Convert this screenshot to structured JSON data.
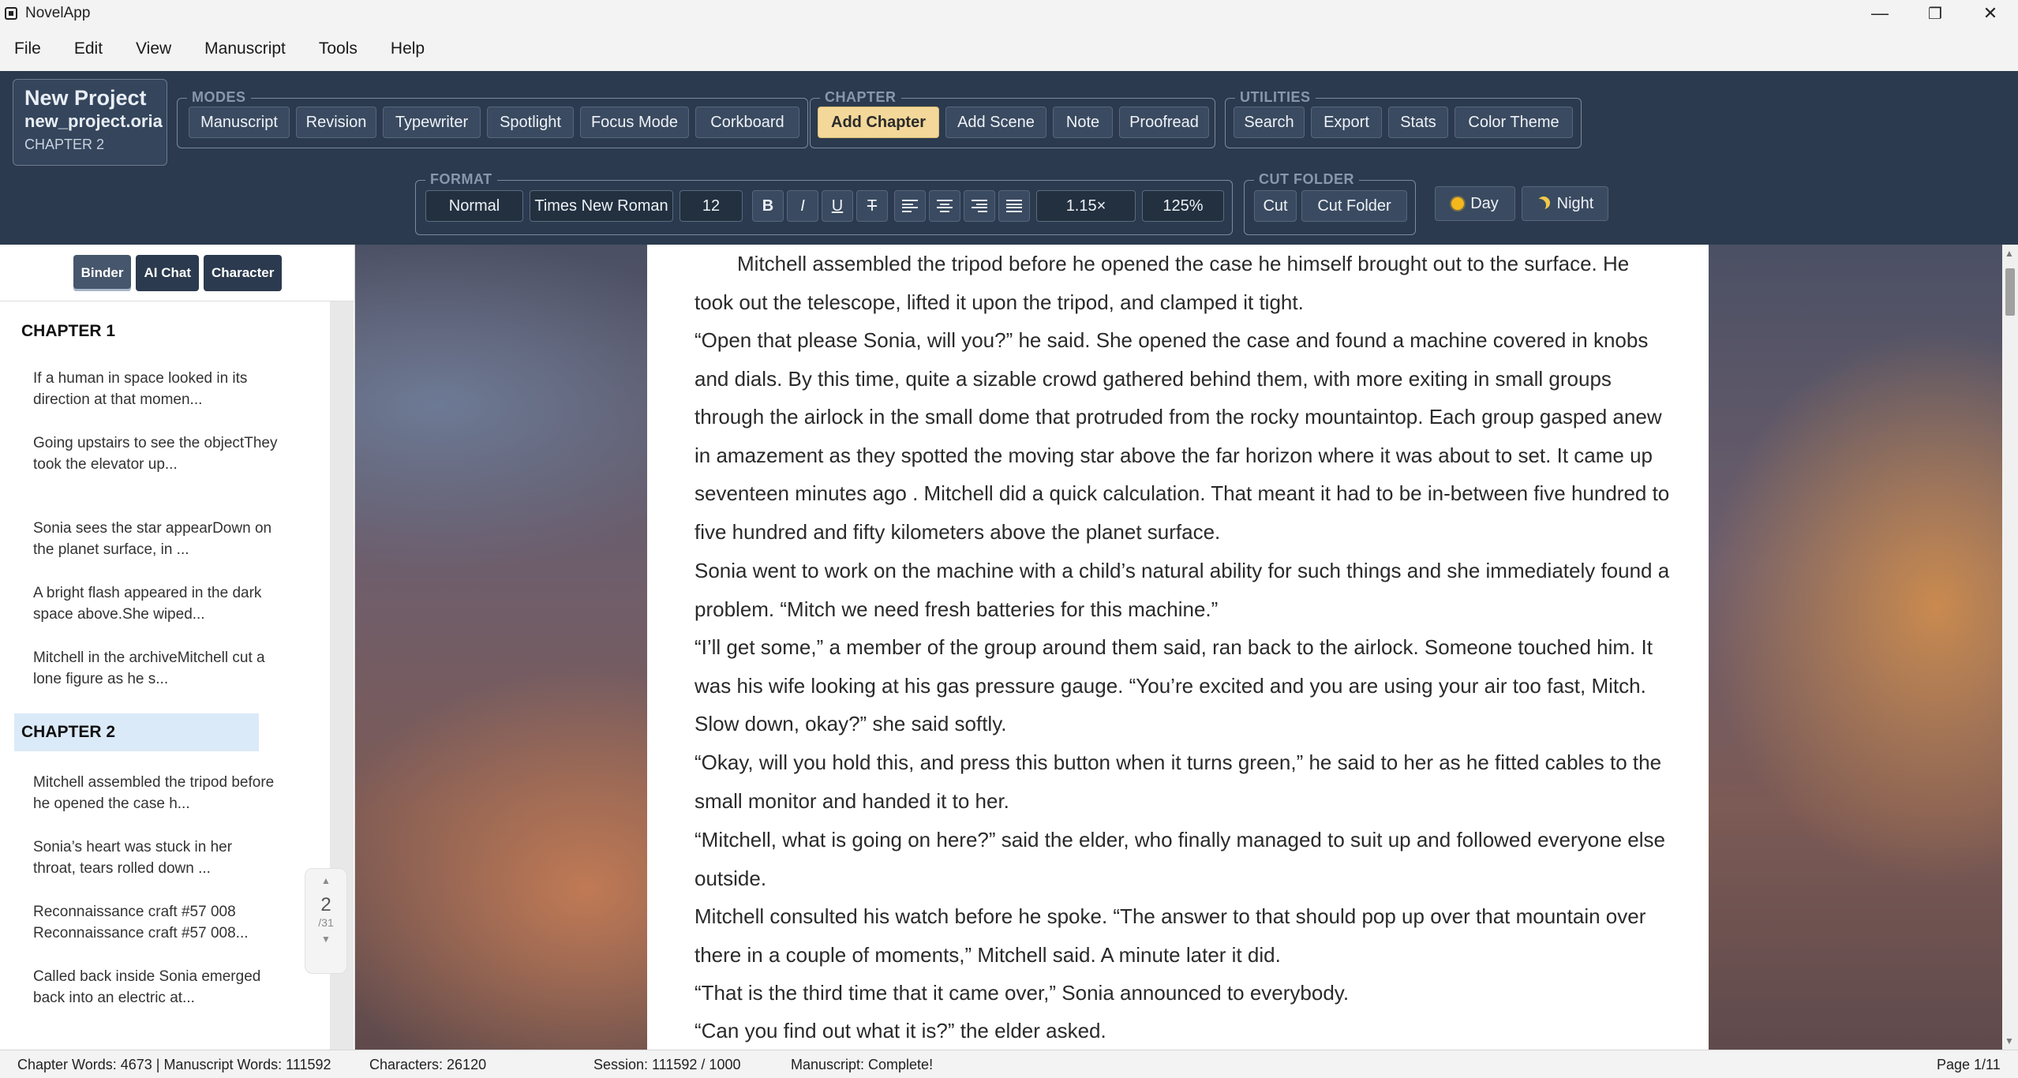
{
  "window": {
    "title": "NovelApp",
    "minimize": "—",
    "maximize": "❐",
    "close": "✕"
  },
  "menu": [
    "File",
    "Edit",
    "View",
    "Manuscript",
    "Tools",
    "Help"
  ],
  "project": {
    "title": "New Project",
    "file": "new_project.oria",
    "chapter": "CHAPTER 2"
  },
  "modes": {
    "label": "MODES",
    "buttons": [
      "Manuscript",
      "Revision",
      "Typewriter",
      "Spotlight",
      "Focus Mode",
      "Corkboard"
    ]
  },
  "chapter_group": {
    "label": "CHAPTER",
    "buttons": [
      "Add Chapter",
      "Add Scene",
      "Note",
      "Proofread"
    ],
    "active": "Add Chapter"
  },
  "utilities": {
    "label": "UTILITIES",
    "buttons": [
      "Search",
      "Export",
      "Stats",
      "Color Theme"
    ]
  },
  "format": {
    "label": "FORMAT",
    "style": "Normal",
    "font": "Times New Roman",
    "size": "12",
    "bold": "B",
    "italic": "I",
    "underline": "U",
    "strike": "T",
    "line_spacing": "1.15×",
    "zoom": "125%"
  },
  "cut_folder": {
    "label": "CUT FOLDER",
    "buttons": [
      "Cut",
      "Cut Folder"
    ]
  },
  "theme": {
    "day": "Day",
    "night": "Night"
  },
  "panel_tabs": [
    "Binder",
    "AI Chat",
    "Character"
  ],
  "binder": {
    "chapter1": {
      "title": "CHAPTER 1",
      "scenes": [
        "If a human in space looked in its direction at that momen...",
        "Going upstairs to see the objectThey took the elevator up...",
        "Sonia sees the star appearDown on the planet surface, in ...",
        "A bright flash appeared in the dark space above.She wiped...",
        "Mitchell in the archiveMitchell cut a lone figure as he s..."
      ]
    },
    "chapter2": {
      "title": "CHAPTER 2",
      "scenes": [
        "Mitchell assembled the tripod before he opened the case h...",
        "Sonia’s heart was stuck in her throat, tears rolled down ...",
        "Reconnaissance craft #57 008 Reconnaissance craft #57 008...",
        "Called back inside Sonia emerged back into an electric at..."
      ]
    },
    "page_indicator": {
      "current": "2",
      "total": "/31",
      "up": "▲",
      "down": "▼"
    }
  },
  "editor": {
    "paragraphs": [
      "Mitchell assembled the tripod before he opened the case he himself brought out to the surface. He took out the telescope, lifted it upon the tripod, and clamped it tight.",
      "“Open that please Sonia, will you?” he said. She opened the case and found a machine covered in knobs and dials. By this time, quite a sizable crowd gathered behind them, with more exiting in small groups through the airlock in the small dome that protruded from the rocky mountaintop. Each group gasped anew in amazement as they spotted the moving star above the far horizon where it was about to set. It came up seventeen minutes ago . Mitchell did a quick calculation. That meant it had to be in-between five hundred to five hundred and fifty kilometers above the planet surface.",
      "Sonia went to work on the machine with a child’s natural ability for such things and she immediately found a problem. “Mitch we need fresh batteries for this machine.”",
      "“I’ll get some,” a member of the group around them said, ran back to the airlock. Someone touched him. It was his wife looking at his gas pressure gauge. “You’re excited and you are using your air too fast, Mitch. Slow down, okay?” she said softly.",
      "“Okay, will you hold this, and press this button when it turns green,” he said to her as he fitted cables to the small monitor and handed it to her.",
      "“Mitchell, what is going on here?” said the elder, who finally managed to suit up and followed everyone else outside.",
      "Mitchell consulted his watch before he spoke. “The answer to that should pop up over that mountain over there in a couple of moments,” Mitchell said. A minute later it did.",
      "“That is the third time that it came over,” Sonia announced to everybody.",
      "“Can you find out what it is?” the elder asked."
    ]
  },
  "status": {
    "words": "Chapter Words: 4673 | Manuscript Words: 111592",
    "characters": "Characters: 26120",
    "session": "Session: 111592 / 1000",
    "manuscript": "Manuscript: Complete!",
    "page": "Page 1/11"
  }
}
